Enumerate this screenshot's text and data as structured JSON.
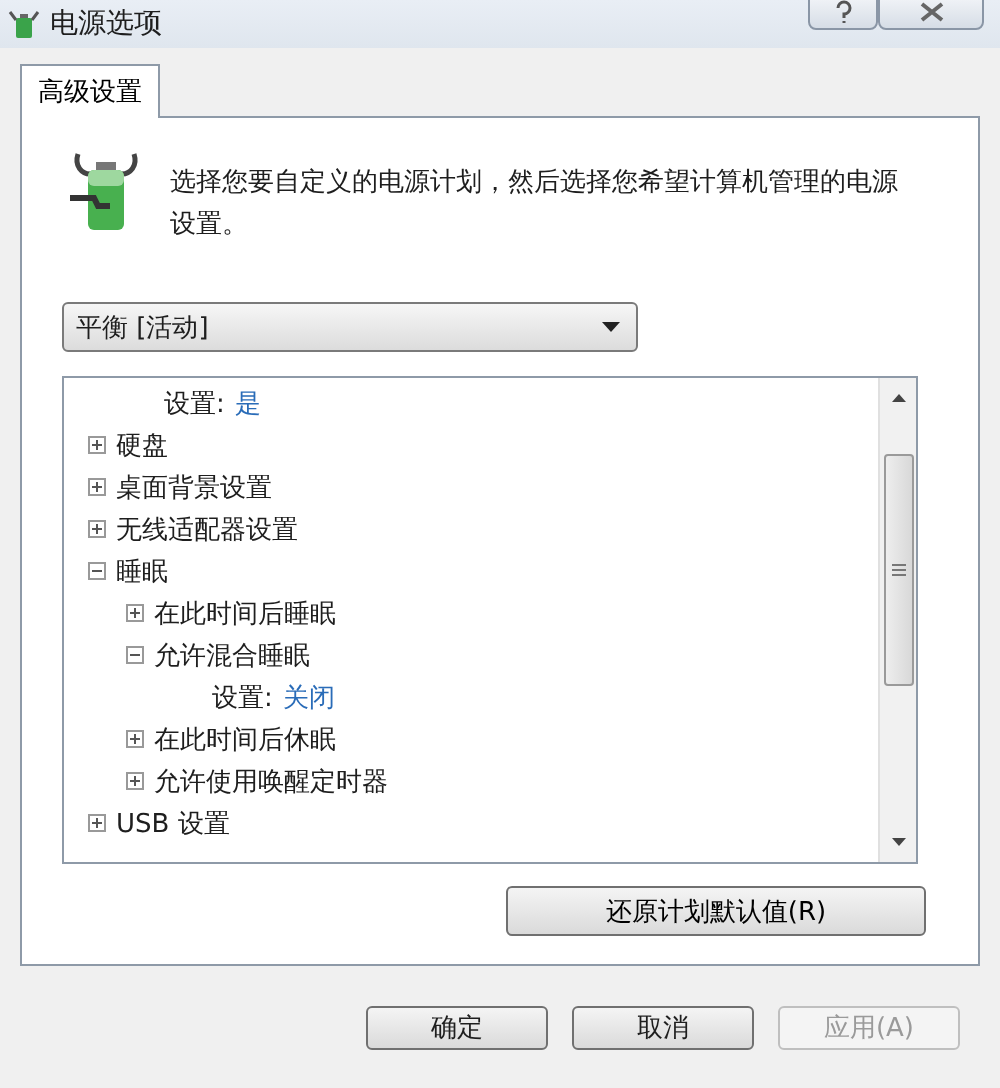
{
  "window": {
    "title": "电源选项"
  },
  "tabs": [
    {
      "label": "高级设置",
      "selected": true
    }
  ],
  "description": "选择您要自定义的电源计划，然后选择您希望计算机管理的电源设置。",
  "plan_dropdown": {
    "value": "平衡 [活动]"
  },
  "tree": [
    {
      "kind": "setting",
      "label": "设置:",
      "value": "是"
    },
    {
      "kind": "group",
      "label": "硬盘",
      "expanded": false
    },
    {
      "kind": "group",
      "label": "桌面背景设置",
      "expanded": false
    },
    {
      "kind": "group",
      "label": "无线适配器设置",
      "expanded": false
    },
    {
      "kind": "group",
      "label": "睡眠",
      "expanded": true,
      "children": [
        {
          "kind": "group",
          "label": "在此时间后睡眠",
          "expanded": false
        },
        {
          "kind": "group",
          "label": "允许混合睡眠",
          "expanded": true,
          "children": [
            {
              "kind": "setting",
              "label": "设置:",
              "value": "关闭"
            }
          ]
        },
        {
          "kind": "group",
          "label": "在此时间后休眠",
          "expanded": false
        },
        {
          "kind": "group",
          "label": "允许使用唤醒定时器",
          "expanded": false
        }
      ]
    },
    {
      "kind": "group",
      "label": "USB 设置",
      "expanded": false
    }
  ],
  "restore_button": "还原计划默认值(R)",
  "buttons": [
    {
      "label": "确定",
      "disabled": false
    },
    {
      "label": "取消",
      "disabled": false
    },
    {
      "label": "应用(A)",
      "disabled": true
    }
  ]
}
